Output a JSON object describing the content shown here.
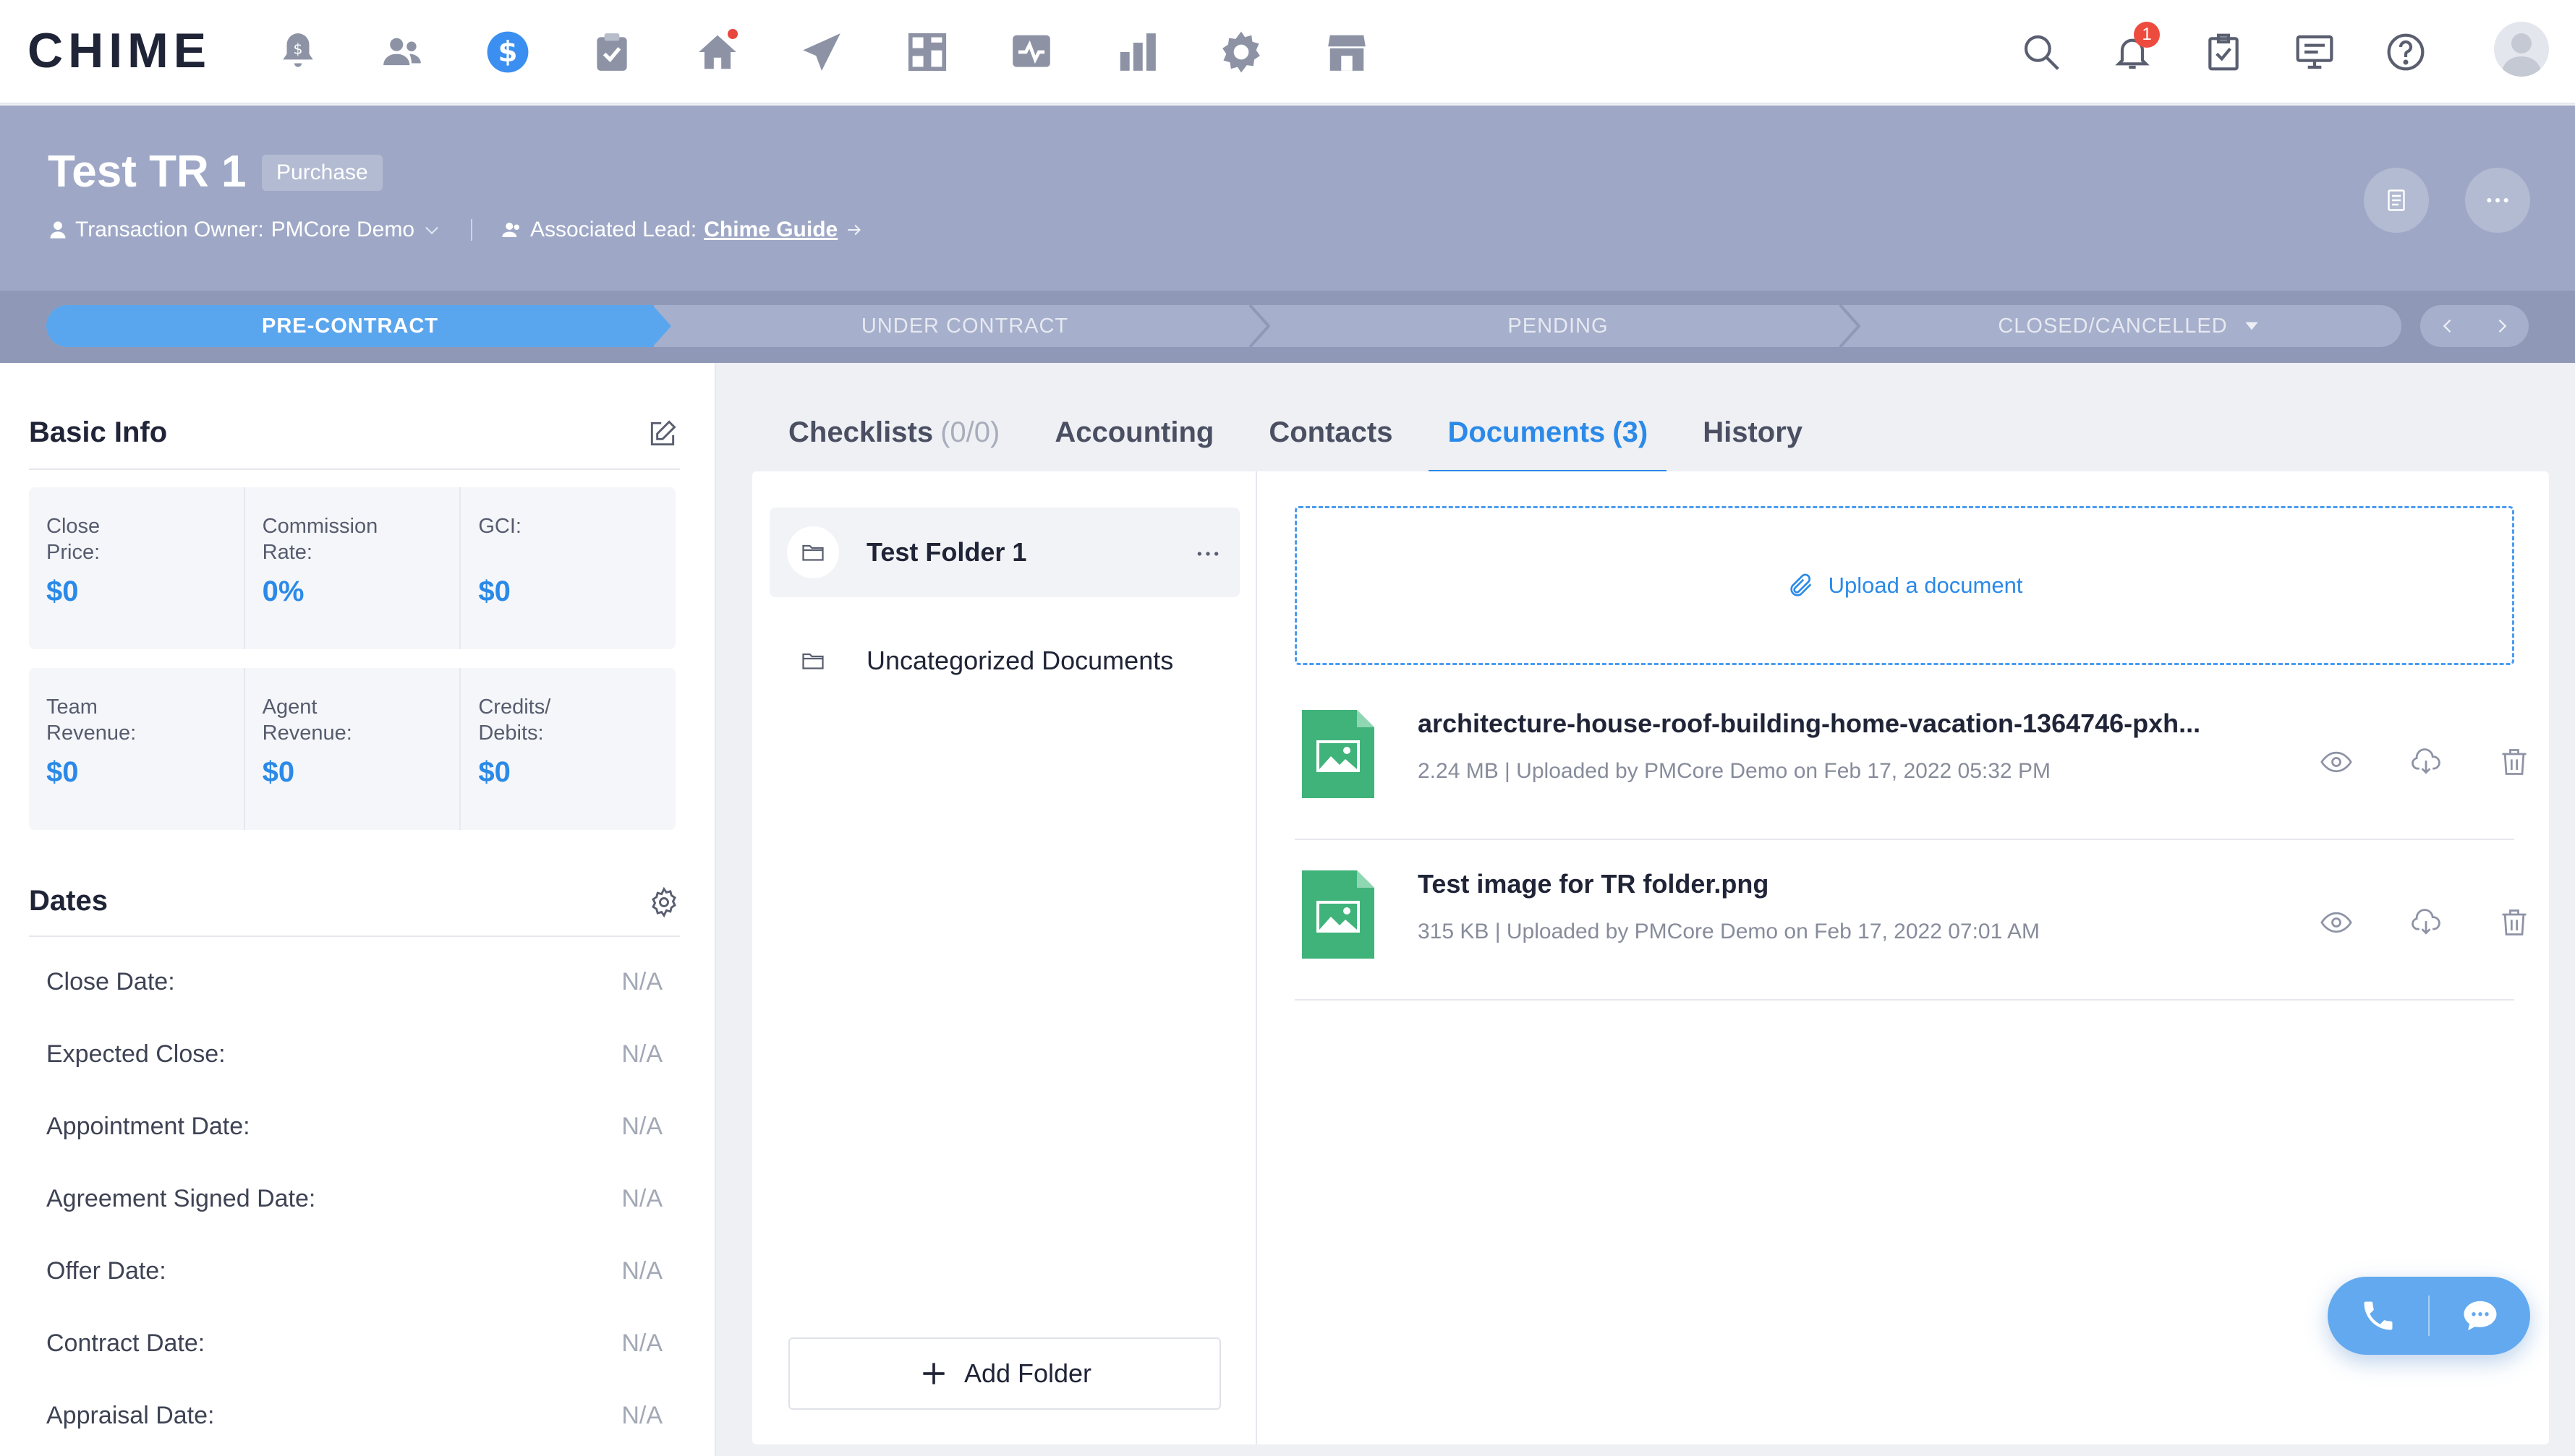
{
  "app": {
    "logo": "CHIME"
  },
  "topnav": {
    "left_icons": [
      "alert-icon",
      "people-icon",
      "dollar-icon",
      "clipboard-check-icon",
      "home-icon",
      "paper-plane-icon",
      "dashboard-icon",
      "activity-icon",
      "bar-chart-icon",
      "gear-icon",
      "store-icon"
    ],
    "right_icons": [
      "search-icon",
      "bell-icon",
      "task-icon",
      "presentation-icon",
      "help-icon"
    ],
    "notification_count": "1",
    "active_color": "#3b8ff0"
  },
  "transaction": {
    "title": "Test TR 1",
    "type": "Purchase",
    "owner_label": "Transaction Owner:",
    "owner_name": "PMCore Demo",
    "lead_label": "Associated Lead:",
    "lead_name": "Chime Guide"
  },
  "stages": {
    "items": [
      "PRE-CONTRACT",
      "UNDER CONTRACT",
      "PENDING",
      "CLOSED/CANCELLED"
    ],
    "active": "PRE-CONTRACT",
    "active_color": "#5aa6ee"
  },
  "basic_info": {
    "title": "Basic Info",
    "row1": [
      {
        "label": "Close\nPrice:",
        "value": "$0"
      },
      {
        "label": "Commission\nRate:",
        "value": "0%"
      },
      {
        "label": "GCI:",
        "value": "$0"
      }
    ],
    "row2": [
      {
        "label": "Team\nRevenue:",
        "value": "$0"
      },
      {
        "label": "Agent\nRevenue:",
        "value": "$0"
      },
      {
        "label": "Credits/\nDebits:",
        "value": "$0"
      }
    ]
  },
  "dates": {
    "title": "Dates",
    "rows": [
      {
        "label": "Close Date:",
        "value": "N/A"
      },
      {
        "label": "Expected Close:",
        "value": "N/A"
      },
      {
        "label": "Appointment Date:",
        "value": "N/A"
      },
      {
        "label": "Agreement Signed Date:",
        "value": "N/A"
      },
      {
        "label": "Offer Date:",
        "value": "N/A"
      },
      {
        "label": "Contract Date:",
        "value": "N/A"
      },
      {
        "label": "Appraisal Date:",
        "value": "N/A"
      }
    ]
  },
  "tabs": [
    {
      "label": "Checklists",
      "count": "(0/0)"
    },
    {
      "label": "Accounting",
      "count": ""
    },
    {
      "label": "Contacts",
      "count": ""
    },
    {
      "label": "Documents",
      "count": "(3)"
    },
    {
      "label": "History",
      "count": ""
    }
  ],
  "active_tab": "Documents",
  "folders": {
    "items": [
      "Test Folder 1",
      "Uncategorized Documents"
    ],
    "selected": "Test Folder 1",
    "add_label": "Add Folder"
  },
  "upload": {
    "label": "Upload a document"
  },
  "documents": [
    {
      "name": "architecture-house-roof-building-home-vacation-1364746-pxh...",
      "meta": "2.24 MB | Uploaded by PMCore Demo on Feb 17, 2022 05:32 PM"
    },
    {
      "name": "Test image for TR folder.png",
      "meta": "315 KB | Uploaded by PMCore Demo on Feb 17, 2022 07:01 AM"
    }
  ],
  "doc_icon_color": "#3fb37a",
  "call_widget": {
    "icons": [
      "phone-icon",
      "chat-icon"
    ]
  }
}
